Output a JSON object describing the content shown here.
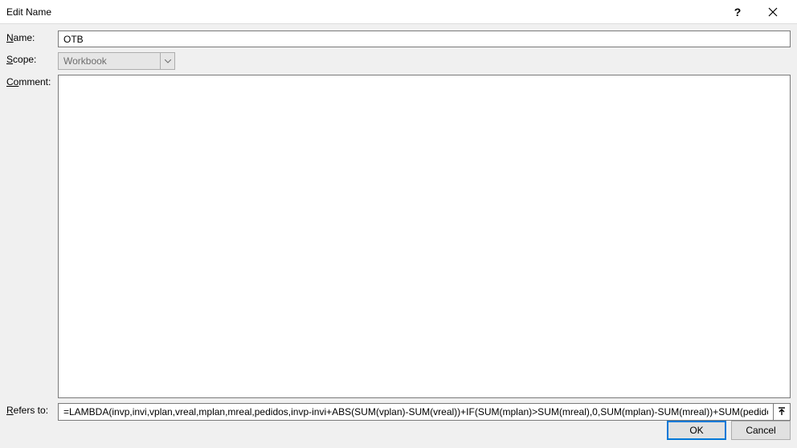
{
  "title": "Edit Name",
  "labels": {
    "name": "ame:",
    "name_u": "N",
    "scope": "cope:",
    "scope_u": "S",
    "comment": "mment:",
    "comment_u": "Co",
    "refers": "efers to:",
    "refers_u": "R"
  },
  "fields": {
    "name_value": "OTB",
    "scope_value": "Workbook",
    "comment_value": "",
    "refers_value": "=LAMBDA(invp,invi,vplan,vreal,mplan,mreal,pedidos,invp-invi+ABS(SUM(vplan)-SUM(vreal))+IF(SUM(mplan)>SUM(mreal),0,SUM(mplan)-SUM(mreal))+SUM(pedidos))"
  },
  "buttons": {
    "ok": "OK",
    "cancel": "Cancel"
  }
}
